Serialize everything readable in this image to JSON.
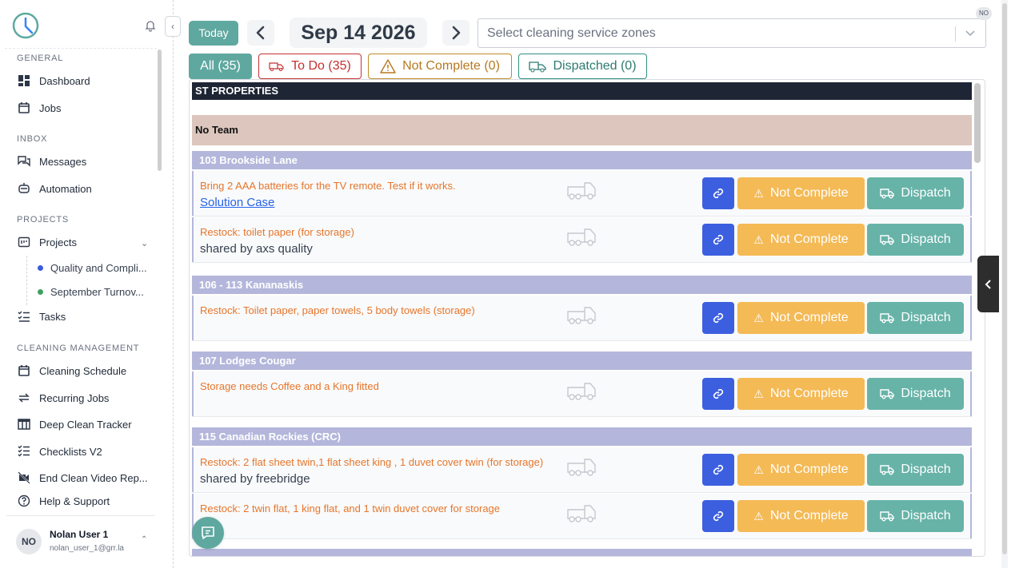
{
  "sidebar": {
    "sections": {
      "general": "GENERAL",
      "inbox": "INBOX",
      "projects": "PROJECTS",
      "cleaning": "CLEANING MANAGEMENT"
    },
    "items": {
      "dashboard": "Dashboard",
      "jobs": "Jobs",
      "messages": "Messages",
      "automation": "Automation",
      "projects": "Projects",
      "project_1": "Quality and Compli...",
      "project_2": "September Turnov...",
      "tasks": "Tasks",
      "cleaning_schedule": "Cleaning Schedule",
      "recurring_jobs": "Recurring Jobs",
      "deep_clean": "Deep Clean Tracker",
      "checklists": "Checklists V2",
      "end_clean": "End Clean Video Rep...",
      "help": "Help & Support"
    },
    "project_colors": [
      "#3b5bdb",
      "#40a060"
    ],
    "user": {
      "initials": "NO",
      "name": "Nolan User 1",
      "email": "nolan_user_1@grr.la"
    }
  },
  "toolbar": {
    "today_label": "Today",
    "date": "Sep 14 2026",
    "zone_placeholder": "Select cleaning service zones",
    "corner_badge": "NO"
  },
  "filters": {
    "all": "All (35)",
    "todo": "To Do (35)",
    "not_complete": "Not Complete (0)",
    "dispatched": "Dispatched (0)"
  },
  "board": {
    "org": "ST PROPERTIES",
    "team": "No Team",
    "properties": [
      {
        "name": "103 Brookside Lane",
        "tasks": [
          {
            "text": "Bring 2 AAA batteries for the TV remote. Test if it works.",
            "link": "Solution Case",
            "sub": ""
          },
          {
            "text": "Restock: toilet paper (for storage)",
            "link": "",
            "sub": "shared by axs quality"
          }
        ]
      },
      {
        "name": "106 - 113 Kananaskis",
        "tasks": [
          {
            "text": "Restock: Toilet paper, paper towels, 5 body towels (storage)",
            "link": "",
            "sub": ""
          }
        ]
      },
      {
        "name": "107 Lodges Cougar",
        "tasks": [
          {
            "text": "Storage needs Coffee and a King fitted",
            "link": "",
            "sub": ""
          }
        ]
      },
      {
        "name": "115 Canadian Rockies (CRC)",
        "tasks": [
          {
            "text": "Restock: 2 flat sheet twin,1 flat sheet king , 1 duvet cover twin (for storage)",
            "link": "",
            "sub": "shared by freebridge"
          },
          {
            "text": "Restock: 2 twin flat, 1 king flat, and 1 twin duvet cover for storage",
            "link": "",
            "sub": ""
          }
        ]
      }
    ],
    "actions": {
      "not_complete": "Not Complete",
      "dispatch": "Dispatch"
    }
  },
  "colors": {
    "teal": "#5fa8a0",
    "todo_red": "#c53030",
    "warning": "#f4ba56",
    "link_blue": "#3c5fe0",
    "property_header": "#b4b7db",
    "org_header": "#1e2535",
    "team_header": "#dcc6bd"
  }
}
